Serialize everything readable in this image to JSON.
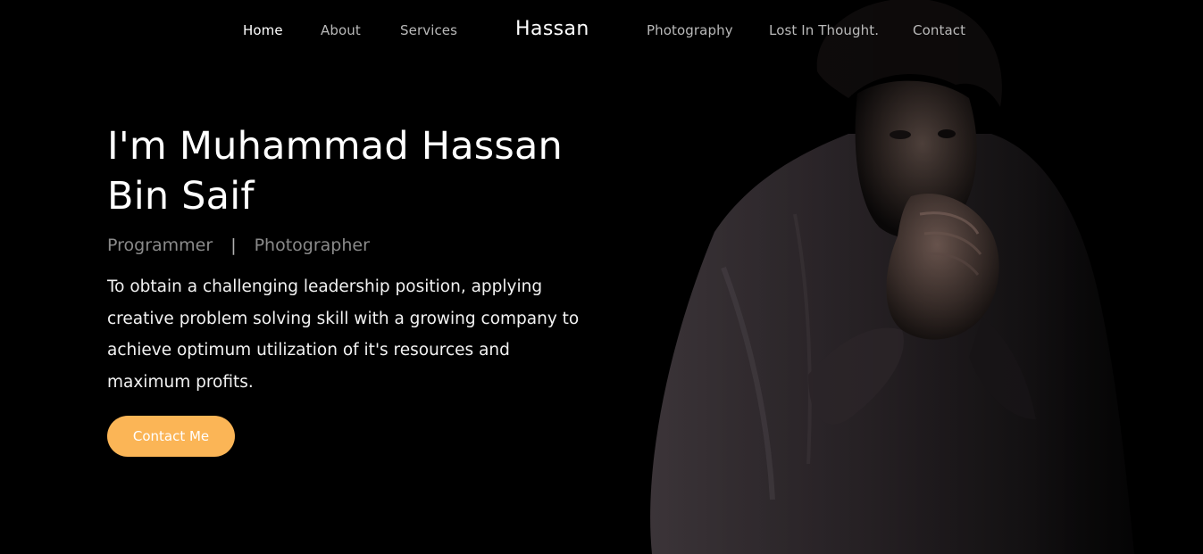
{
  "nav": {
    "brand": "Hassan",
    "links_left": [
      {
        "label": "Home",
        "active": true
      },
      {
        "label": "About",
        "active": false
      },
      {
        "label": "Services",
        "active": false
      }
    ],
    "links_right": [
      {
        "label": "Photography",
        "active": false
      },
      {
        "label": "Lost In Thought.",
        "active": false
      },
      {
        "label": "Contact",
        "active": false
      }
    ]
  },
  "hero": {
    "title_line1": "I'm Muhammad Hassan",
    "title_line2": "Bin Saif",
    "role_1": "Programmer",
    "role_separator": "|",
    "role_2": "Photographer",
    "summary": "To obtain a challenging leadership position, applying creative problem solving skill with a growing company to achieve optimum utilization of it's resources and maximum profits.",
    "cta_label": "Contact Me"
  },
  "portrait": {
    "icon": "person-portrait-photo"
  },
  "colors": {
    "background": "#000000",
    "accent": "#fbb556",
    "nav_active": "#ffffff",
    "nav_inactive": "#b9b9b9",
    "roles": "#8a8a8a"
  }
}
